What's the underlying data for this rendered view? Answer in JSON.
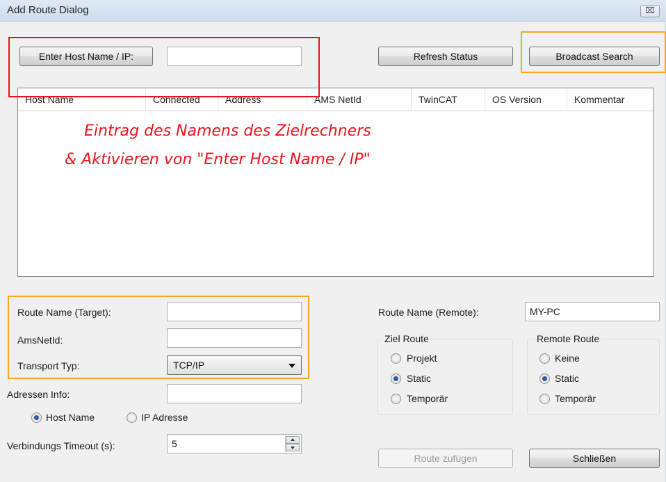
{
  "window": {
    "title": "Add Route Dialog",
    "close_glyph": "⌧"
  },
  "top": {
    "enter_host_label": "Enter Host Name / IP:",
    "host_input_value": "",
    "refresh_label": "Refresh Status",
    "broadcast_label": "Broadcast Search"
  },
  "list": {
    "columns": [
      "Host Name",
      "Connected",
      "Address",
      "AMS NetId",
      "TwinCAT",
      "OS Version",
      "Kommentar"
    ]
  },
  "annotation": {
    "line1": "Eintrag des Namens des Zielrechners",
    "line2": "& Aktivieren von \"Enter Host Name / IP\"",
    "color": "#e8141b",
    "highlight_orange": "#f5a623"
  },
  "form": {
    "route_name_target_label": "Route Name (Target):",
    "route_name_target_value": "",
    "amsnetid_label": "AmsNetId:",
    "amsnetid_value": "",
    "transport_label": "Transport Typ:",
    "transport_value": "TCP/IP",
    "adressen_label": "Adressen Info:",
    "adressen_value": "",
    "host_name_radio": "Host Name",
    "ip_adresse_radio": "IP Adresse",
    "timeout_label": "Verbindungs Timeout (s):",
    "timeout_value": "5",
    "route_name_remote_label": "Route Name (Remote):",
    "route_name_remote_value": "MY-PC"
  },
  "ziel_route": {
    "title": "Ziel Route",
    "options": [
      "Projekt",
      "Static",
      "Temporär"
    ],
    "selected": "Static"
  },
  "remote_route": {
    "title": "Remote Route",
    "options": [
      "Keine",
      "Static",
      "Temporär"
    ],
    "selected": "Static"
  },
  "footer": {
    "add_route_label": "Route zufügen",
    "close_label": "Schließen"
  }
}
